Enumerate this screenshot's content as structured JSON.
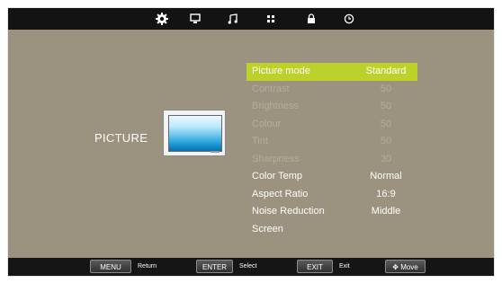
{
  "top_tabs": [
    {
      "icon": "gear-icon",
      "active": true
    },
    {
      "icon": "monitor-icon",
      "active": false
    },
    {
      "icon": "music-note-icon",
      "active": false
    },
    {
      "icon": "grid-icon",
      "active": false
    },
    {
      "icon": "lock-icon",
      "active": false
    },
    {
      "icon": "clock-icon",
      "active": false
    }
  ],
  "section": {
    "title": "PICTURE"
  },
  "menu": {
    "items": [
      {
        "label": "Picture  mode",
        "value": "Standard",
        "state": "selected"
      },
      {
        "label": "Contrast",
        "value": "50",
        "state": "disabled"
      },
      {
        "label": "Brightness",
        "value": "50",
        "state": "disabled"
      },
      {
        "label": "Colour",
        "value": "50",
        "state": "disabled"
      },
      {
        "label": " Tint",
        "value": "50",
        "state": "disabled"
      },
      {
        "label": "Sharpness",
        "value": "30",
        "state": "disabled"
      },
      {
        "label": "Color  Temp",
        "value": "Normal",
        "state": "normal"
      },
      {
        "label": "Aspect Ratio",
        "value": "16:9",
        "state": "normal"
      },
      {
        "label": "Noise Reduction",
        "value": "Middle",
        "state": "normal"
      },
      {
        "label": "Screen",
        "value": "",
        "state": "normal"
      }
    ]
  },
  "bottom_hints": {
    "menu_key": "MENU",
    "menu_hint": "Return",
    "enter_key": "ENTER",
    "enter_hint": "Select",
    "exit_key": "EXIT",
    "exit_hint": "Exit",
    "move_key": "Move"
  },
  "colors": {
    "background": "#9b9380",
    "bar": "#131313",
    "highlight": "#bcd22a",
    "disabled_text": "#b4ad9e"
  }
}
